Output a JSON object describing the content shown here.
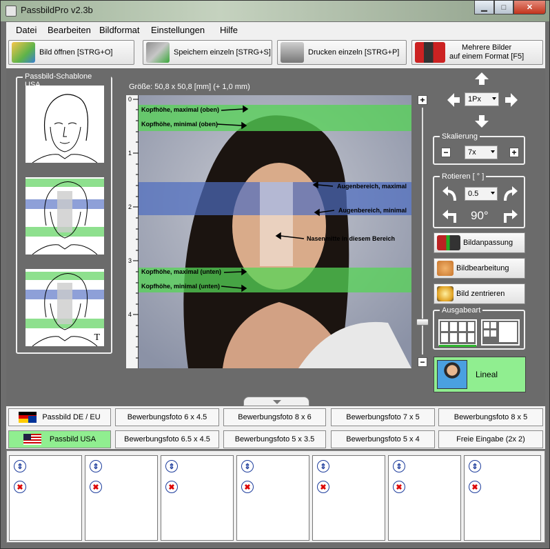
{
  "window": {
    "title": "PassbildPro  v2.3b",
    "minimize_glyph": "▁",
    "maximize_glyph": "□",
    "close_glyph": "✕"
  },
  "menu": [
    "Datei",
    "Bearbeiten",
    "Bildformat",
    "Einstellungen",
    "Hilfe"
  ],
  "toolbar": {
    "open": "Bild öffnen [STRG+O]",
    "save": "Speichern einzeln [STRG+S]",
    "print": "Drucken einzeln [STRG+P]",
    "multi_line1": "Mehrere Bilder",
    "multi_line2": "auf einem Format [F5]"
  },
  "template_group": {
    "title": "Passbild-Schablone USA",
    "t_mark": "T"
  },
  "size_label": "Größe: 50,8 x 50,8 [mm] (+ 1,0 mm)",
  "ruler_marks": [
    "0",
    "1",
    "2",
    "3",
    "4"
  ],
  "annotations": {
    "head_max_top": "Kopfhöhe, maximal (oben)",
    "head_min_top": "Kopfhöhe, minimal (oben)",
    "eye_max": "Augenbereich, maximal",
    "eye_min": "Augenbereich, minimal",
    "nose": "Nasenmitte in diesem Bereich",
    "head_max_bottom": "Kopfhöhe, maximal (unten)",
    "head_min_bottom": "Kopfhöhe, minimal (unten)"
  },
  "zoom": {
    "plus": "+",
    "minus": "−"
  },
  "move": {
    "step": "1Px"
  },
  "scale": {
    "title": "Skalierung",
    "value": "7x",
    "minus": "−",
    "plus": "+"
  },
  "rotate": {
    "title": "Rotieren [ ° ]",
    "value": "0.5",
    "ninety": "90°"
  },
  "actions": {
    "adjust": "Bildanpassung",
    "edit": "Bildbearbeitung",
    "center": "Bild zentrieren"
  },
  "output": {
    "title": "Ausgabeart"
  },
  "lineal": "Lineal",
  "tabs_row1": [
    "Passbild DE / EU",
    "Bewerbungsfoto 6 x 4.5",
    "Bewerbungsfoto 8 x 6",
    "Bewerbungsfoto 7 x 5",
    "Bewerbungsfoto 8 x 5"
  ],
  "tabs_row2": [
    "Passbild USA",
    "Bewerbungsfoto 6.5 x 4.5",
    "Bewerbungsfoto 5 x 3.5",
    "Bewerbungsfoto 5 x 4",
    "Freie Eingabe (2x 2)"
  ],
  "colors": {
    "active_tab": "#90ee90",
    "green_band": "#56d456",
    "blue_band": "#4d6cc0"
  }
}
